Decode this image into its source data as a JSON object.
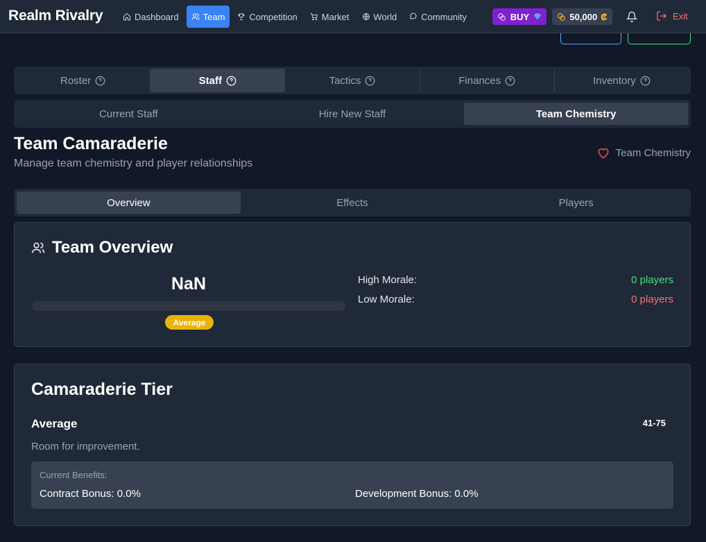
{
  "nav": {
    "brand": "Realm Rivalry",
    "items": [
      {
        "label": "Dashboard",
        "icon": "home-icon",
        "active": false
      },
      {
        "label": "Team",
        "icon": "users-icon",
        "active": true
      },
      {
        "label": "Competition",
        "icon": "trophy-icon",
        "active": false
      },
      {
        "label": "Market",
        "icon": "cart-icon",
        "active": false
      },
      {
        "label": "World",
        "icon": "globe-icon",
        "active": false
      },
      {
        "label": "Community",
        "icon": "chat-icon",
        "active": false
      }
    ],
    "buy_label": "BUY",
    "coins": "50,000",
    "coin_symbol": "₡",
    "exit_label": "Exit"
  },
  "main_tabs": [
    "Roster",
    "Staff",
    "Tactics",
    "Finances",
    "Inventory"
  ],
  "main_tabs_active": "Staff",
  "sub_tabs": [
    "Current Staff",
    "Hire New Staff",
    "Team Chemistry"
  ],
  "sub_tabs_active": "Team Chemistry",
  "header": {
    "title": "Team Camaraderie",
    "subtitle": "Manage team chemistry and player relationships",
    "link_label": "Team Chemistry"
  },
  "inner_tabs": [
    "Overview",
    "Effects",
    "Players"
  ],
  "inner_tabs_active": "Overview",
  "overview": {
    "title": "Team Overview",
    "score": "NaN",
    "bar_fill_percent": 0,
    "badge": "Average",
    "high_morale_label": "High Morale:",
    "high_morale_value": "0 players",
    "low_morale_label": "Low Morale:",
    "low_morale_value": "0 players"
  },
  "tier": {
    "title": "Camaraderie Tier",
    "name": "Average",
    "range": "41-75",
    "description": "Room for improvement.",
    "benefits_label": "Current Benefits:",
    "contract_bonus": "Contract Bonus: 0.0%",
    "development_bonus": "Development Bonus: 0.0%"
  },
  "colors": {
    "accent": "#3b82f6",
    "buy": "#7e22ce",
    "badge": "#eab308",
    "good": "#4ade80",
    "bad": "#f87171"
  }
}
